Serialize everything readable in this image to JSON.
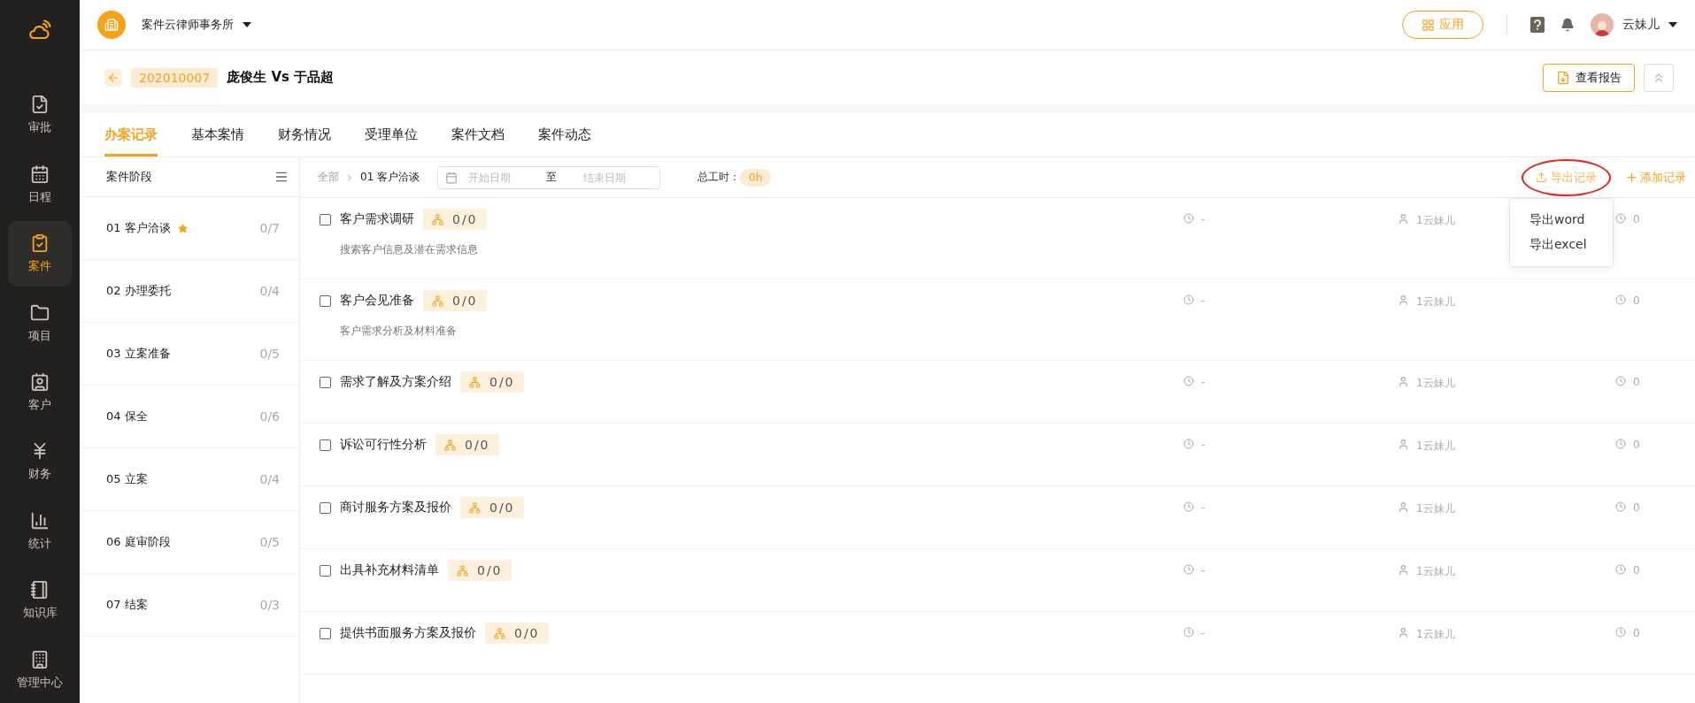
{
  "sidebar": {
    "items": [
      {
        "label": "审批",
        "selected": false
      },
      {
        "label": "日程",
        "selected": false
      },
      {
        "label": "案件",
        "selected": true
      },
      {
        "label": "项目",
        "selected": false
      },
      {
        "label": "客户",
        "selected": false
      },
      {
        "label": "财务",
        "selected": false
      },
      {
        "label": "统计",
        "selected": false
      },
      {
        "label": "知识库",
        "selected": false
      },
      {
        "label": "管理中心",
        "selected": false
      }
    ]
  },
  "topbar": {
    "organization": "案件云律师事务所",
    "apps_button": "应用",
    "user_name": "云妹儿"
  },
  "header": {
    "case_number": "202010007",
    "title": "庞俊生 Vs 于品超",
    "report_button": "查看报告"
  },
  "tabs": [
    {
      "label": "办案记录",
      "selected": true
    },
    {
      "label": "基本案情",
      "selected": false
    },
    {
      "label": "财务情况",
      "selected": false
    },
    {
      "label": "受理单位",
      "selected": false
    },
    {
      "label": "案件文档",
      "selected": false
    },
    {
      "label": "案件动态",
      "selected": false
    }
  ],
  "stages": {
    "header": "案件阶段",
    "items": [
      {
        "label": "01 客户洽谈",
        "count": "0/7",
        "starred": true
      },
      {
        "label": "02 办理委托",
        "count": "0/4",
        "starred": false
      },
      {
        "label": "03 立案准备",
        "count": "0/5",
        "starred": false
      },
      {
        "label": "04 保全",
        "count": "0/6",
        "starred": false
      },
      {
        "label": "05 立案",
        "count": "0/4",
        "starred": false
      },
      {
        "label": "06 庭审阶段",
        "count": "0/5",
        "starred": false
      },
      {
        "label": "07 结案",
        "count": "0/3",
        "starred": false
      }
    ]
  },
  "toolbar": {
    "breadcrumb": [
      "全部",
      "01 客户洽谈"
    ],
    "start_placeholder": "开始日期",
    "range_separator": "至",
    "end_placeholder": "结束日期",
    "total_label": "总工时：",
    "total_hours": "0h",
    "export_button": "导出记录",
    "export_circled": true,
    "add_button": "添加记录"
  },
  "export_menu": {
    "open": true,
    "items": [
      "导出word",
      "导出excel"
    ]
  },
  "tasks": [
    {
      "title": "客户需求调研",
      "checked": false,
      "progress": "0/0",
      "description": "搜索客户信息及潜在需求信息",
      "time": "-",
      "assignee": "1云妹儿",
      "hours": "0"
    },
    {
      "title": "客户会见准备",
      "checked": false,
      "progress": "0/0",
      "description": "客户需求分析及材料准备",
      "time": "-",
      "assignee": "1云妹儿",
      "hours": "0"
    },
    {
      "title": "需求了解及方案介绍",
      "checked": false,
      "progress": "0/0",
      "time": "-",
      "assignee": "1云妹儿",
      "hours": "0"
    },
    {
      "title": "诉讼可行性分析",
      "checked": false,
      "progress": "0/0",
      "time": "-",
      "assignee": "1云妹儿",
      "hours": "0"
    },
    {
      "title": "商讨服务方案及报价",
      "checked": false,
      "progress": "0/0",
      "time": "-",
      "assignee": "1云妹儿",
      "hours": "0"
    },
    {
      "title": "出具补充材料清单",
      "checked": false,
      "progress": "0/0",
      "time": "-",
      "assignee": "1云妹儿",
      "hours": "0"
    },
    {
      "title": "提供书面服务方案及报价",
      "checked": false,
      "progress": "0/0",
      "time": "-",
      "assignee": "1云妹儿",
      "hours": "0"
    }
  ]
}
